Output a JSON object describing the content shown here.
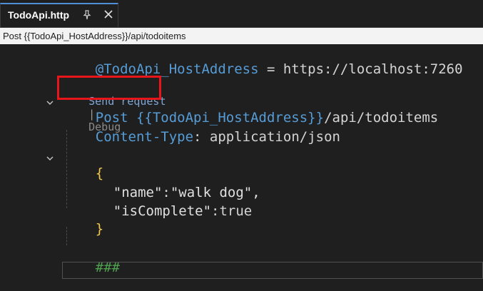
{
  "tab": {
    "title": "TodoApi.http",
    "pin_icon": "pin-icon",
    "close_icon": "close-icon"
  },
  "navbar": {
    "text": "Post {{TodoApi_HostAddress}}/api/todoitems"
  },
  "code": {
    "line1_var": "@TodoApi_HostAddress",
    "line1_rest": " = https://localhost:7260",
    "codelens_send": "Send request",
    "codelens_sep": "|",
    "codelens_debug": "Debug",
    "line3_method": "Post ",
    "line3_var": "{{TodoApi_HostAddress}}",
    "line3_path": "/api/todoitems",
    "line4_header": "Content-Type",
    "line4_value": ": application/json",
    "open_brace": "{",
    "name_key": "\"name\"",
    "name_colon": ":",
    "name_value": "\"walk dog\",",
    "iscomplete_key": "\"isComplete\"",
    "iscomplete_rest": ":true",
    "close_brace": "}",
    "separator": "###"
  },
  "colors": {
    "highlight": "#e8151b",
    "accent": "#4f8fd8"
  }
}
